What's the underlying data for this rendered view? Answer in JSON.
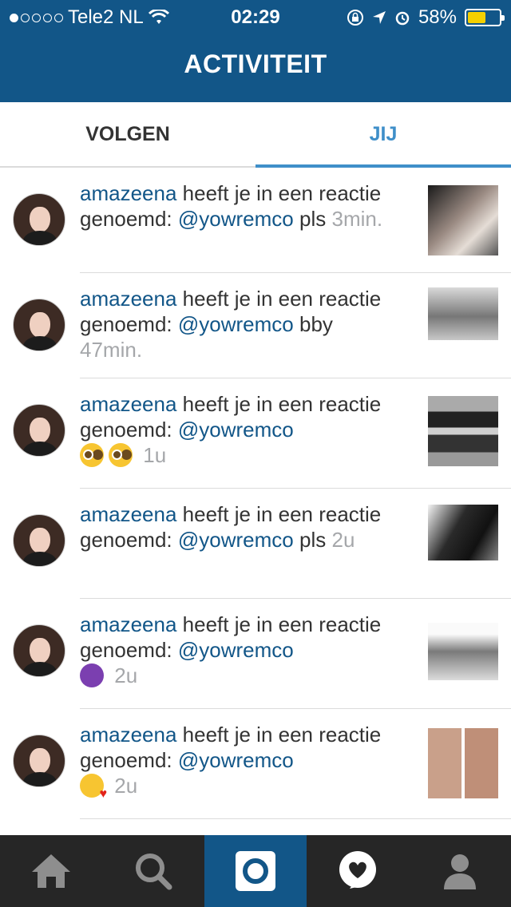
{
  "status_bar": {
    "carrier": "Tele2 NL",
    "time": "02:29",
    "battery": "58%",
    "battery_level": 0.58,
    "signal_bars": 1
  },
  "header": {
    "title": "ACTIVITEIT"
  },
  "tabs": [
    {
      "label": "VOLGEN",
      "active": false
    },
    {
      "label": "JIJ",
      "active": true
    }
  ],
  "notifications": [
    {
      "user": "amazeena",
      "action": "heeft je in een reactie genoemd:",
      "mention": "@yowremco",
      "comment": "pls",
      "emoji": "",
      "time": "3min."
    },
    {
      "user": "amazeena",
      "action": "heeft je in een reactie genoemd:",
      "mention": "@yowremco",
      "comment": "bby",
      "emoji": "",
      "time": "47min."
    },
    {
      "user": "amazeena",
      "action": "heeft je in een reactie genoemd:",
      "mention": "@yowremco",
      "comment": "",
      "emoji": "flushed-face-x2",
      "time": "1u"
    },
    {
      "user": "amazeena",
      "action": "heeft je in een reactie genoemd:",
      "mention": "@yowremco",
      "comment": "pls",
      "emoji": "",
      "time": "2u"
    },
    {
      "user": "amazeena",
      "action": "heeft je in een reactie genoemd:",
      "mention": "@yowremco",
      "comment": "",
      "emoji": "smiling-devil",
      "time": "2u"
    },
    {
      "user": "amazeena",
      "action": "heeft je in een reactie genoemd:",
      "mention": "@yowremco",
      "comment": "",
      "emoji": "kiss-face",
      "time": "2u"
    }
  ],
  "tab_bar": {
    "items": [
      "home-icon",
      "search-icon",
      "camera-icon",
      "activity-heart-icon",
      "profile-icon"
    ],
    "active_index": 2
  },
  "colors": {
    "brand": "#125688",
    "accent": "#3f8fc9",
    "tabbar": "#262626"
  }
}
